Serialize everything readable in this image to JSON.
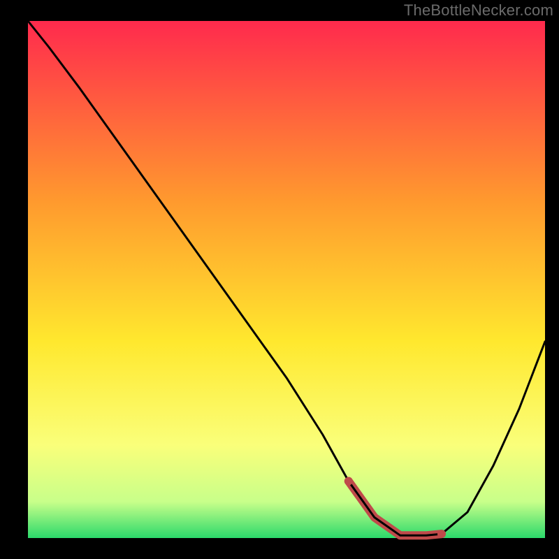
{
  "watermark": "TheBottleNecker.com",
  "colors": {
    "curve": "#000000",
    "marker_stroke": "#bf4a4a",
    "marker_fill": "#bf4a4a",
    "gradient_top": "#ff2a4d",
    "gradient_mid1": "#ff9a2e",
    "gradient_mid2": "#ffe82e",
    "gradient_mid3": "#faff7a",
    "gradient_bottom1": "#c8ff8a",
    "gradient_bottom2": "#2bd96b",
    "background": "#000000"
  },
  "chart_data": {
    "type": "line",
    "title": "",
    "xlabel": "",
    "ylabel": "",
    "xlim": [
      0,
      100
    ],
    "ylim": [
      0,
      100
    ],
    "grid": false,
    "legend": false,
    "series": [
      {
        "name": "bottleneck-curve",
        "x": [
          0,
          4,
          10,
          20,
          30,
          40,
          50,
          57,
          62,
          67,
          72,
          77,
          80,
          85,
          90,
          95,
          100
        ],
        "y": [
          100,
          95,
          87,
          73,
          59,
          45,
          31,
          20,
          11,
          4,
          0.5,
          0.5,
          0.8,
          5,
          14,
          25,
          38
        ]
      }
    ],
    "highlight": {
      "name": "optimal-range",
      "x": [
        62,
        67,
        72,
        77,
        80
      ],
      "y": [
        11,
        4,
        0.5,
        0.5,
        0.8
      ]
    },
    "note": "Y values estimated from vertical position of curve relative to plot height; x estimated from horizontal fraction of plot width. Precision ≈ ±3."
  }
}
